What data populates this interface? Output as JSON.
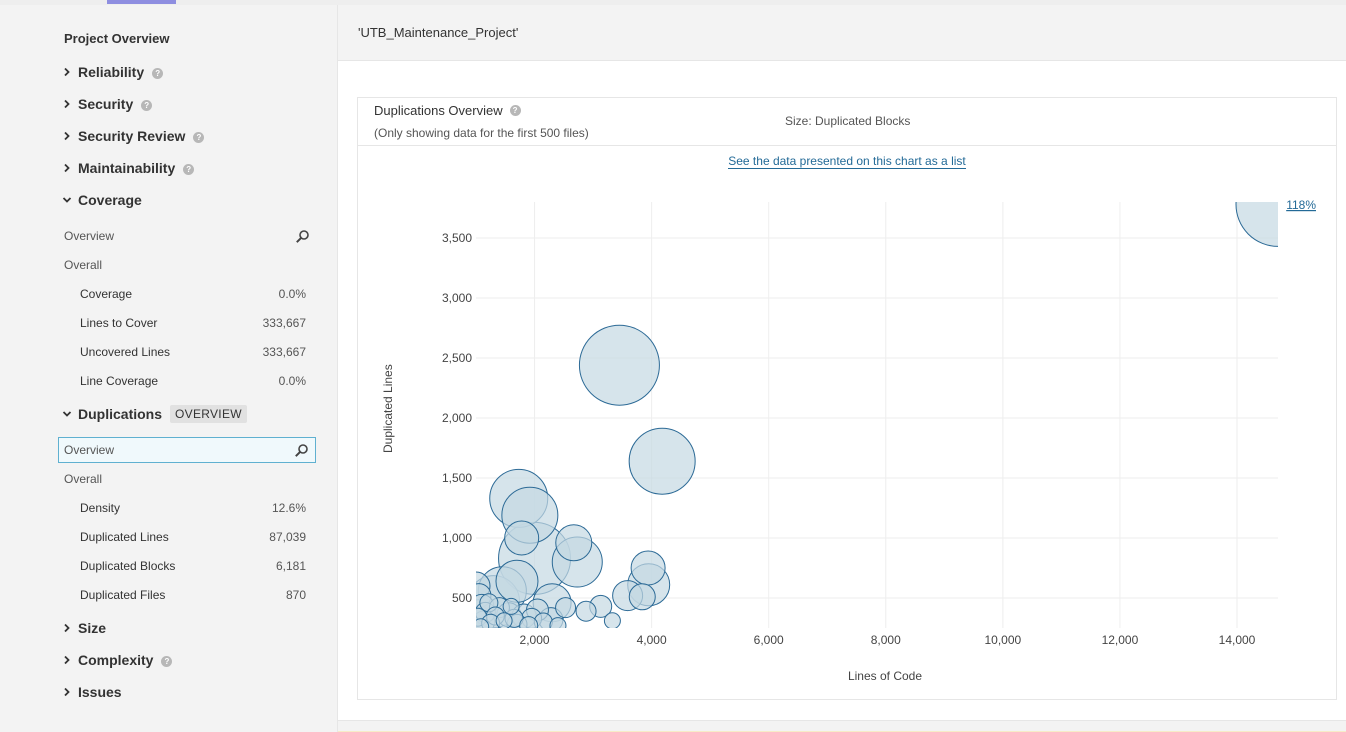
{
  "sidebar": {
    "title": "Project Overview",
    "domains": [
      {
        "label": "Reliability",
        "help": true,
        "expanded": false
      },
      {
        "label": "Security",
        "help": true,
        "expanded": false
      },
      {
        "label": "Security Review",
        "help": true,
        "expanded": false
      },
      {
        "label": "Maintainability",
        "help": true,
        "expanded": false
      },
      {
        "label": "Coverage",
        "help": false,
        "expanded": true
      },
      {
        "label": "Duplications",
        "help": false,
        "expanded": true,
        "badge": "OVERVIEW"
      },
      {
        "label": "Size",
        "help": false,
        "expanded": false
      },
      {
        "label": "Complexity",
        "help": true,
        "expanded": false
      },
      {
        "label": "Issues",
        "help": false,
        "expanded": false
      }
    ],
    "coverage": {
      "overview_label": "Overview",
      "overall_label": "Overall",
      "metrics": [
        {
          "label": "Coverage",
          "value": "0.0%"
        },
        {
          "label": "Lines to Cover",
          "value": "333,667"
        },
        {
          "label": "Uncovered Lines",
          "value": "333,667"
        },
        {
          "label": "Line Coverage",
          "value": "0.0%"
        }
      ]
    },
    "duplications": {
      "overview_label": "Overview",
      "overall_label": "Overall",
      "metrics": [
        {
          "label": "Density",
          "value": "12.6%"
        },
        {
          "label": "Duplicated Lines",
          "value": "87,039"
        },
        {
          "label": "Duplicated Blocks",
          "value": "6,181"
        },
        {
          "label": "Duplicated Files",
          "value": "870"
        }
      ]
    }
  },
  "header": {
    "project_name": "'UTB_Maintenance_Project'"
  },
  "panel": {
    "title": "Duplications Overview",
    "subtitle": "(Only showing data for the first 500 files)",
    "size_label": "Size: Duplicated Blocks",
    "list_link": "See the data presented on this chart as a list",
    "zoom_label": "118%"
  },
  "colors": {
    "bubble_fill": "#c5d8e3",
    "bubble_stroke": "#2c6a96",
    "link": "#236a97",
    "grid": "#eeeeee"
  },
  "chart_data": {
    "type": "scatter",
    "xlabel": "Lines of Code",
    "ylabel": "Duplicated Lines",
    "xlim": [
      1000,
      14700
    ],
    "ylim": [
      250,
      3800
    ],
    "xticks": [
      2000,
      4000,
      6000,
      8000,
      10000,
      12000,
      14000
    ],
    "xtick_labels": [
      "2,000",
      "4,000",
      "6,000",
      "8,000",
      "10,000",
      "12,000",
      "14,000"
    ],
    "yticks": [
      500,
      1000,
      1500,
      2000,
      2500,
      3000,
      3500
    ],
    "ytick_labels": [
      "500",
      "1,000",
      "1,500",
      "2,000",
      "2,500",
      "3,000",
      "3,500"
    ],
    "points": [
      {
        "x": 14700,
        "y": 3780,
        "size": 42
      },
      {
        "x": 3450,
        "y": 2440,
        "size": 40
      },
      {
        "x": 4180,
        "y": 1640,
        "size": 33
      },
      {
        "x": 1730,
        "y": 1330,
        "size": 29
      },
      {
        "x": 1920,
        "y": 1190,
        "size": 28
      },
      {
        "x": 2000,
        "y": 830,
        "size": 36
      },
      {
        "x": 1780,
        "y": 1000,
        "size": 17
      },
      {
        "x": 2730,
        "y": 800,
        "size": 25
      },
      {
        "x": 2670,
        "y": 960,
        "size": 18
      },
      {
        "x": 1700,
        "y": 640,
        "size": 21
      },
      {
        "x": 1300,
        "y": 470,
        "size": 26
      },
      {
        "x": 1450,
        "y": 560,
        "size": 24
      },
      {
        "x": 2300,
        "y": 460,
        "size": 19
      },
      {
        "x": 3940,
        "y": 750,
        "size": 17
      },
      {
        "x": 3950,
        "y": 610,
        "size": 21
      },
      {
        "x": 3840,
        "y": 510,
        "size": 13
      },
      {
        "x": 3590,
        "y": 520,
        "size": 15
      },
      {
        "x": 3130,
        "y": 430,
        "size": 11
      },
      {
        "x": 2880,
        "y": 390,
        "size": 10
      },
      {
        "x": 2530,
        "y": 420,
        "size": 10
      },
      {
        "x": 3330,
        "y": 310,
        "size": 8
      },
      {
        "x": 2280,
        "y": 320,
        "size": 12
      },
      {
        "x": 1000,
        "y": 600,
        "size": 14
      },
      {
        "x": 1050,
        "y": 520,
        "size": 12
      },
      {
        "x": 1100,
        "y": 430,
        "size": 12
      },
      {
        "x": 1160,
        "y": 380,
        "size": 10
      },
      {
        "x": 1220,
        "y": 460,
        "size": 9
      },
      {
        "x": 1330,
        "y": 350,
        "size": 9
      },
      {
        "x": 1400,
        "y": 420,
        "size": 10
      },
      {
        "x": 1560,
        "y": 360,
        "size": 12
      },
      {
        "x": 1650,
        "y": 330,
        "size": 9
      },
      {
        "x": 1820,
        "y": 350,
        "size": 12
      },
      {
        "x": 1950,
        "y": 330,
        "size": 10
      },
      {
        "x": 2050,
        "y": 400,
        "size": 11
      },
      {
        "x": 2150,
        "y": 300,
        "size": 9
      },
      {
        "x": 1130,
        "y": 300,
        "size": 11
      },
      {
        "x": 1030,
        "y": 340,
        "size": 9
      },
      {
        "x": 1480,
        "y": 310,
        "size": 8
      },
      {
        "x": 1250,
        "y": 290,
        "size": 9
      },
      {
        "x": 1700,
        "y": 280,
        "size": 10
      },
      {
        "x": 2400,
        "y": 270,
        "size": 8
      },
      {
        "x": 1900,
        "y": 270,
        "size": 9
      },
      {
        "x": 1080,
        "y": 260,
        "size": 8
      },
      {
        "x": 1600,
        "y": 430,
        "size": 8
      }
    ]
  }
}
